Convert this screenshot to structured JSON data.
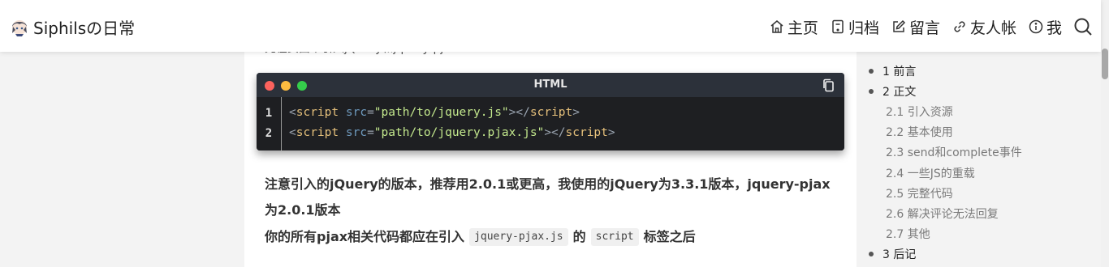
{
  "site": {
    "title": "Siphilsの日常",
    "avatar_icon": "anime-avatar-icon"
  },
  "nav": {
    "items": [
      {
        "label": "主页",
        "icon": "home-icon"
      },
      {
        "label": "归档",
        "icon": "archive-icon"
      },
      {
        "label": "留言",
        "icon": "edit-icon"
      },
      {
        "label": "友人帐",
        "icon": "link-icon"
      },
      {
        "label": "我",
        "icon": "info-icon"
      }
    ],
    "search_icon": "search-icon"
  },
  "article": {
    "cut_line": "先在页面中引入jQuery和jquery-pjax",
    "code_block": {
      "language": "HTML",
      "line_numbers": [
        "1",
        "2"
      ],
      "lines": [
        {
          "open": "<",
          "tag": "script",
          "attr": "src",
          "eq": "=",
          "value": "\"path/to/jquery.js\"",
          "close": "></",
          "tag2": "script",
          "end": ">"
        },
        {
          "open": "<",
          "tag": "script",
          "attr": "src",
          "eq": "=",
          "value": "\"path/to/jquery.pjax.js\"",
          "close": "></",
          "tag2": "script",
          "end": ">"
        }
      ],
      "colors": {
        "window_red": "#fc625d",
        "window_yellow": "#fdbc40",
        "window_green": "#35cd4b",
        "tag": "#e5c07b",
        "string": "#c3e88d"
      }
    },
    "para1": "注意引入的jQuery的版本，推荐用2.0.1或更高，我使用的jQuery为3.3.1版本，jquery-pjax为2.0.1版本",
    "para2": {
      "before": "你的所有pjax相关代码都应在引入",
      "code1": "jquery-pjax.js",
      "middle": "的",
      "code2": "script",
      "after": "标签之后"
    }
  },
  "toc": {
    "items": [
      {
        "text": "1 前言",
        "level": 1
      },
      {
        "text": "2 正文",
        "level": 1
      },
      {
        "text": "2.1 引入资源",
        "level": 2
      },
      {
        "text": "2.2 基本使用",
        "level": 2
      },
      {
        "text": "2.3 send和complete事件",
        "level": 2
      },
      {
        "text": "2.4 一些JS的重载",
        "level": 2
      },
      {
        "text": "2.5 完整代码",
        "level": 2
      },
      {
        "text": "2.6 解决评论无法回复",
        "level": 2
      },
      {
        "text": "2.7 其他",
        "level": 2
      },
      {
        "text": "3 后记",
        "level": 1
      }
    ]
  }
}
